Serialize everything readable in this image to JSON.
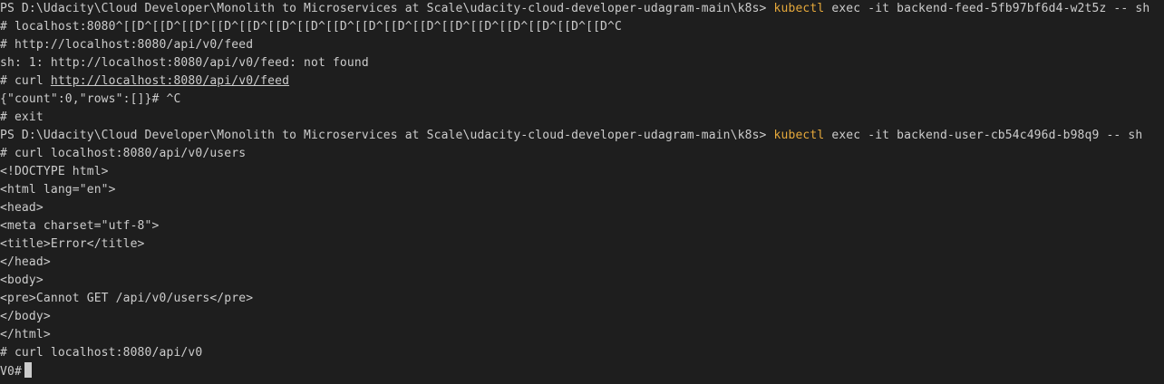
{
  "terminal": {
    "lines": [
      {
        "prompt": "PS D:\\Udacity\\Cloud Developer\\Monolith to Microservices at Scale\\udacity-cloud-developer-udagram-main\\k8s> ",
        "cmd": "kubectl",
        "rest": " exec -it backend-feed-5fb97bf6d4-w2t5z -- sh"
      },
      {
        "text": "# localhost:8080^[[D^[[D^[[D^[[D^[[D^[[D^[[D^[[D^[[D^[[D^[[D^[[D^[[D^[[D^[[D^[[D^[[D^C"
      },
      {
        "text": "# http://localhost:8080/api/v0/feed"
      },
      {
        "text": "sh: 1: http://localhost:8080/api/v0/feed: not found"
      },
      {
        "pre": "# curl ",
        "link": "http://localhost:8080/api/v0/feed"
      },
      {
        "text": "{\"count\":0,\"rows\":[]}# ^C"
      },
      {
        "text": "# exit"
      },
      {
        "prompt": "PS D:\\Udacity\\Cloud Developer\\Monolith to Microservices at Scale\\udacity-cloud-developer-udagram-main\\k8s> ",
        "cmd": "kubectl",
        "rest": " exec -it backend-user-cb54c496d-b98q9 -- sh"
      },
      {
        "text": "# curl localhost:8080/api/v0/users"
      },
      {
        "text": "<!DOCTYPE html>"
      },
      {
        "text": "<html lang=\"en\">"
      },
      {
        "text": "<head>"
      },
      {
        "text": "<meta charset=\"utf-8\">"
      },
      {
        "text": "<title>Error</title>"
      },
      {
        "text": "</head>"
      },
      {
        "text": "<body>"
      },
      {
        "text": "<pre>Cannot GET /api/v0/users</pre>"
      },
      {
        "text": "</body>"
      },
      {
        "text": "</html>"
      },
      {
        "text": "# curl localhost:8080/api/v0"
      },
      {
        "text": "V0#"
      }
    ]
  },
  "colors": {
    "background": "#1e1e1e",
    "foreground": "#cccccc",
    "command_highlight": "#e5a83b",
    "cursor": "#cccccc"
  }
}
